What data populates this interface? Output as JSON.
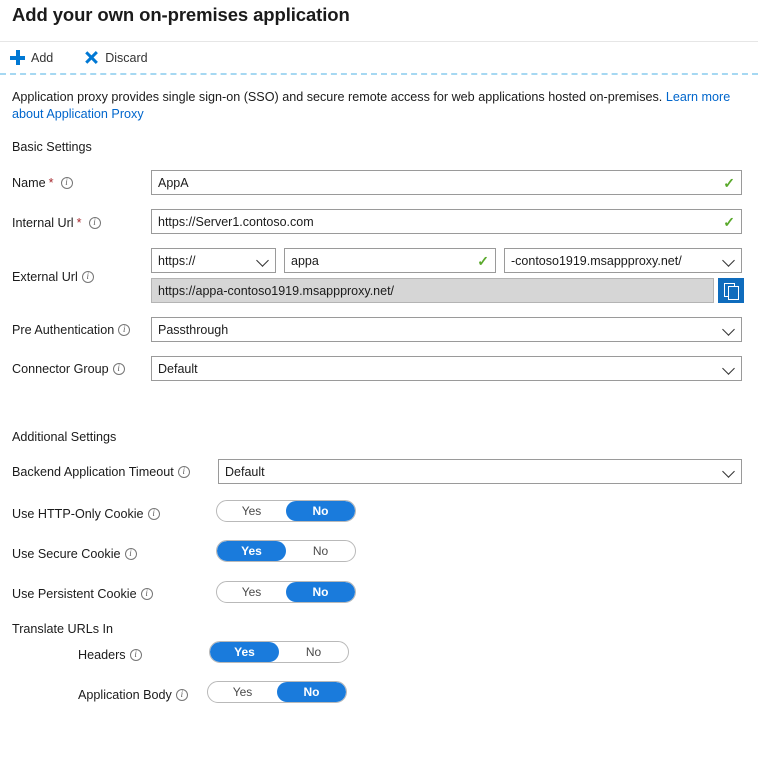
{
  "header": {
    "title": "Add your own on-premises application"
  },
  "toolbar": {
    "add_label": "Add",
    "discard_label": "Discard"
  },
  "description": {
    "text": "Application proxy provides single sign-on (SSO) and secure remote access for web applications hosted on-premises. ",
    "link_text": "Learn more about Application Proxy"
  },
  "sections": {
    "basic": "Basic Settings",
    "additional": "Additional Settings",
    "translate": "Translate URLs In"
  },
  "fields": {
    "name": {
      "label": "Name",
      "required_marker": "*",
      "value": "AppA",
      "valid_mark": "✓"
    },
    "internal_url": {
      "label": "Internal Url",
      "required_marker": "*",
      "value": "https://Server1.contoso.com",
      "valid_mark": "✓"
    },
    "external_url": {
      "label": "External Url",
      "scheme": "https://",
      "host": "appa",
      "host_valid_mark": "✓",
      "domain": "-contoso1919.msappproxy.net/",
      "full_url": "https://appa-contoso1919.msappproxy.net/",
      "copy_icon": "copy-icon"
    },
    "pre_authentication": {
      "label": "Pre Authentication",
      "value": "Passthrough"
    },
    "connector_group": {
      "label": "Connector Group",
      "value": "Default"
    },
    "backend_timeout": {
      "label": "Backend Application Timeout",
      "value": "Default"
    }
  },
  "toggles": {
    "http_only_cookie": {
      "label": "Use HTTP-Only Cookie",
      "yes": "Yes",
      "no": "No",
      "selected": "No"
    },
    "secure_cookie": {
      "label": "Use Secure Cookie",
      "yes": "Yes",
      "no": "No",
      "selected": "Yes"
    },
    "persistent_cookie": {
      "label": "Use Persistent Cookie",
      "yes": "Yes",
      "no": "No",
      "selected": "No"
    },
    "headers": {
      "label": "Headers",
      "yes": "Yes",
      "no": "No",
      "selected": "Yes"
    },
    "application_body": {
      "label": "Application Body",
      "yes": "Yes",
      "no": "No",
      "selected": "No"
    }
  },
  "colors": {
    "accent": "#0078d4",
    "toggle_on": "#1a7bdc",
    "required": "#a4262c",
    "valid": "#5aa92c",
    "link": "#0066cc"
  }
}
